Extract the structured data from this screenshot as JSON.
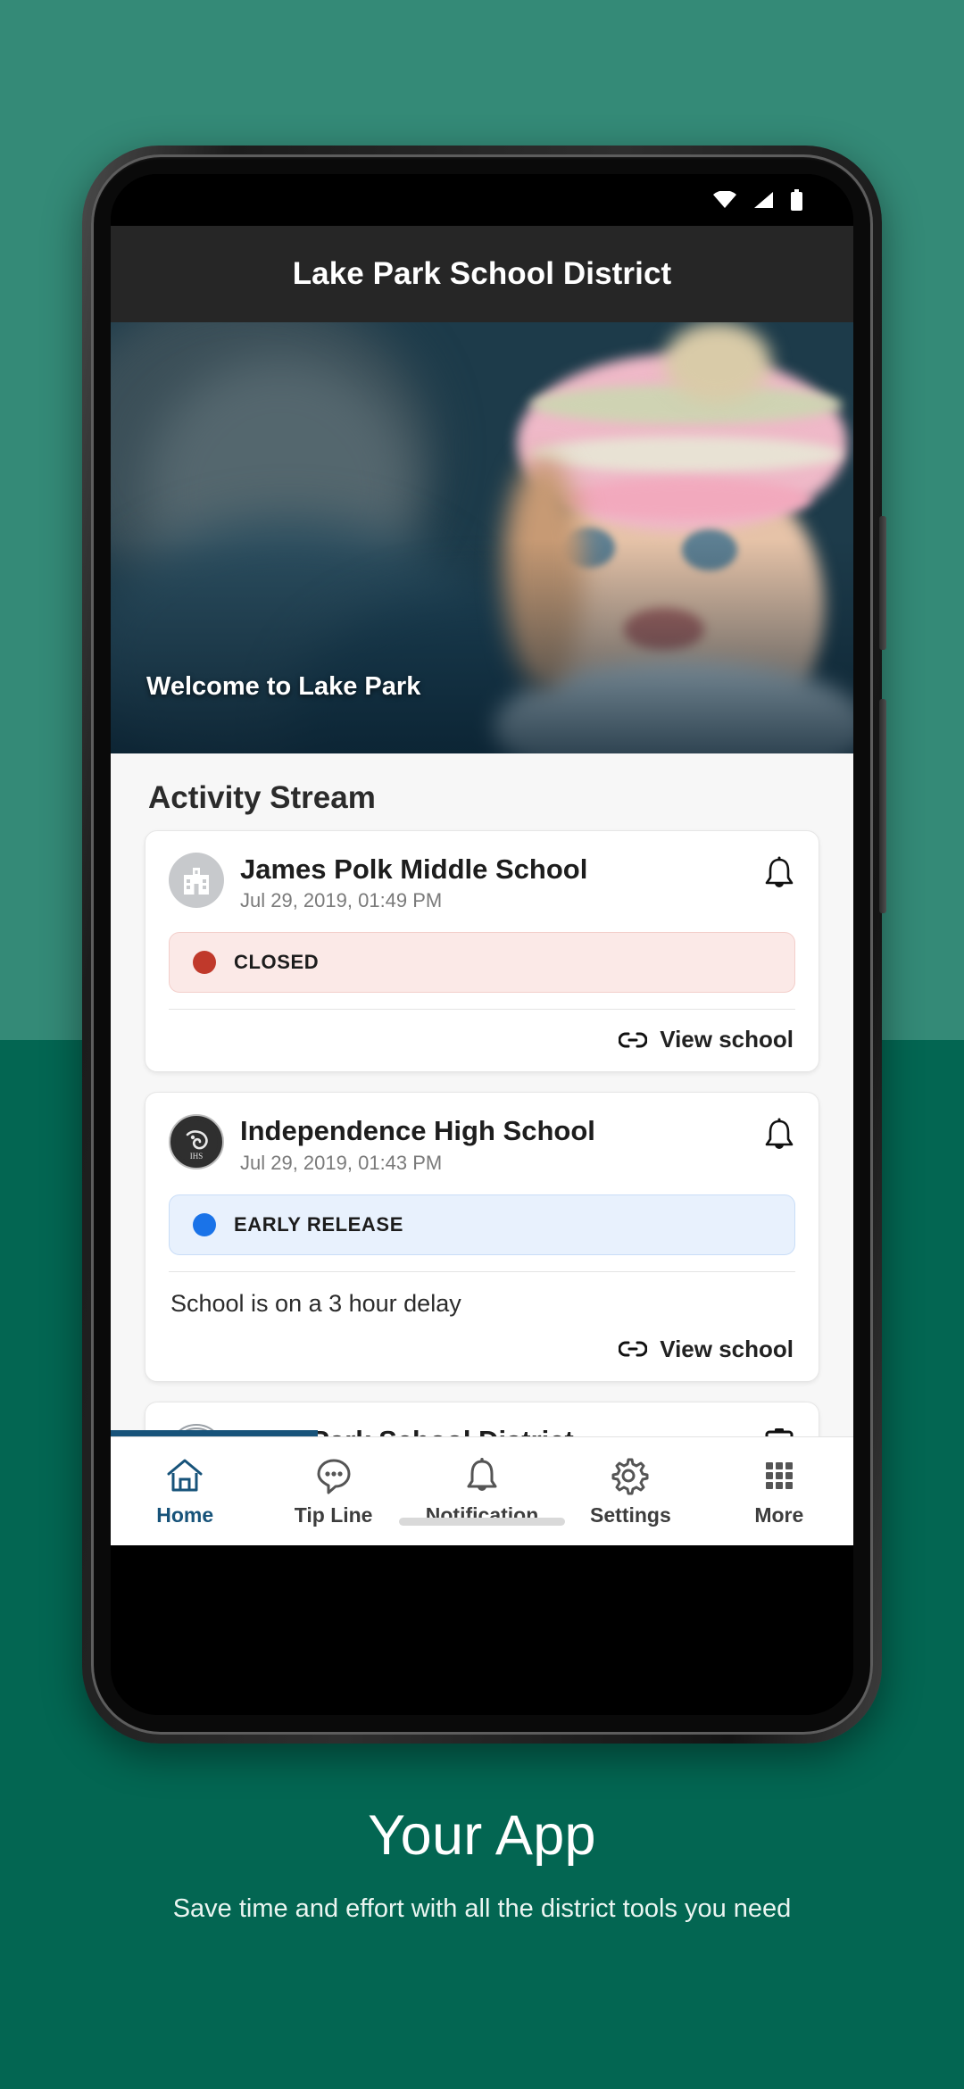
{
  "theme": {
    "bg_top": "#348a77",
    "bg_bottom": "#036652",
    "accent_active": "#17537a",
    "closed_dot": "#c0392b",
    "closed_bg": "#fbe9e7",
    "early_dot": "#1a73e8",
    "early_bg": "#e8f1fd",
    "titlebar_bg": "#262626"
  },
  "status_bar": {
    "wifi_icon": "wifi-icon",
    "signal_icon": "cellular-signal-icon",
    "battery_icon": "battery-icon"
  },
  "app": {
    "title": "Lake Park School District"
  },
  "hero": {
    "caption": "Welcome to Lake Park",
    "image_alt": "child-in-pink-knit-hat-outdoors"
  },
  "stream": {
    "heading": "Activity Stream",
    "cards": [
      {
        "avatar_icon": "school-building-icon",
        "school": "James Polk Middle School",
        "timestamp": "Jul 29, 2019, 01:49 PM",
        "bell_icon": "bell-icon",
        "status_label": "CLOSED",
        "status_type": "closed",
        "body": "",
        "link_icon": "link-icon",
        "link_label": "View school"
      },
      {
        "avatar_icon": "panther-mascot-icon",
        "school": "Independence High School",
        "timestamp": "Jul 29, 2019, 01:43 PM",
        "bell_icon": "bell-icon",
        "status_label": "EARLY RELEASE",
        "status_type": "early",
        "body": "School is on a 3 hour delay",
        "link_icon": "link-icon",
        "link_label": "View school"
      },
      {
        "avatar_icon": "lake-park-seal-icon",
        "school": "Lake Park School District",
        "timestamp": "",
        "bell_icon": "calendar-icon",
        "status_label": "",
        "status_type": "",
        "body": "",
        "link_icon": "",
        "link_label": ""
      }
    ]
  },
  "nav": {
    "items": [
      {
        "label": "Home",
        "icon": "home-icon",
        "active": true
      },
      {
        "label": "Tip Line",
        "icon": "chat-bubble-icon",
        "active": false
      },
      {
        "label": "Notification",
        "icon": "bell-icon",
        "active": false
      },
      {
        "label": "Settings",
        "icon": "gear-icon",
        "active": false
      },
      {
        "label": "More",
        "icon": "grid-dots-icon",
        "active": false
      }
    ]
  },
  "promo": {
    "title": "Your App",
    "subtitle": "Save time and effort with all the district tools you need"
  }
}
